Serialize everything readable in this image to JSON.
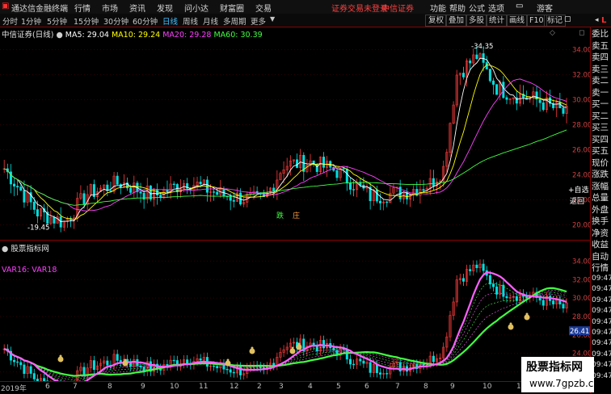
{
  "menubar": {
    "logo_title": "通达信金融终端",
    "menus": [
      "行情",
      "市场",
      "资讯",
      "发现",
      "问小达",
      "财富圈",
      "交易"
    ],
    "login_status": "证券交易未登录",
    "broker": "中信证券",
    "right_menus": [
      "功能",
      "帮助",
      "公式",
      "选项"
    ],
    "user": "游客",
    "colors": {
      "login_status": "#ff4040",
      "broker": "#ff4040"
    }
  },
  "toolbar": {
    "timeframes": [
      "分时",
      "1分钟",
      "5分钟",
      "15分钟",
      "30分钟",
      "60分钟",
      "日线",
      "周线",
      "月线",
      "多周期",
      "更多"
    ],
    "active_timeframe": "日线",
    "buttons": [
      "复权",
      "叠加",
      "多股",
      "统计",
      "画线",
      "F10",
      "标记"
    ],
    "self_select": "+自选",
    "back": "返回"
  },
  "main_chart": {
    "stock_title": "中信证券(日线)",
    "ma": [
      {
        "label": "MA5: 29.04",
        "color": "#ffffff"
      },
      {
        "label": "MA10: 29.24",
        "color": "#ffff00"
      },
      {
        "label": "MA20: 29.28",
        "color": "#ff40ff"
      },
      {
        "label": "MA60: 30.39",
        "color": "#40ff40"
      }
    ],
    "y_ticks": [
      "34.00",
      "32.00",
      "30.00",
      "28.00",
      "26.00",
      "24.00",
      "22.00",
      "20.00"
    ],
    "high_marker": "34.35",
    "low_marker": "19.45",
    "signals": [
      "跌",
      "庄"
    ]
  },
  "indicator": {
    "title": "股票指标网",
    "var_label": "VAR16: VAR18",
    "y_ticks": [
      "34.00",
      "32.00",
      "30.00",
      "28.00",
      "26.00",
      "24.00",
      "22.00"
    ],
    "price_tag": "26.41"
  },
  "x_axis": [
    "2019年",
    "6",
    "7",
    "8",
    "9",
    "10",
    "11",
    "12",
    "2",
    "3",
    "4",
    "5",
    "6",
    "7",
    "8",
    "9",
    "10",
    "11"
  ],
  "right_panel": {
    "items": [
      "委比",
      "卖五",
      "卖四",
      "卖三",
      "卖二",
      "卖一",
      "买一",
      "买二",
      "买三",
      "买四",
      "买五",
      "现价",
      "涨跌",
      "涨幅",
      "总量",
      "外盘",
      "换手",
      "净资",
      "收益",
      "自动",
      "行情"
    ],
    "times": [
      "09:47",
      "09:47",
      "09:47",
      "09:47",
      "09:47",
      "09:47",
      "09:47",
      "09:47",
      "09:47",
      "09:47"
    ],
    "corner": "L"
  },
  "watermark": {
    "title": "股票指标网",
    "url": "www.7gpzb.com"
  }
}
